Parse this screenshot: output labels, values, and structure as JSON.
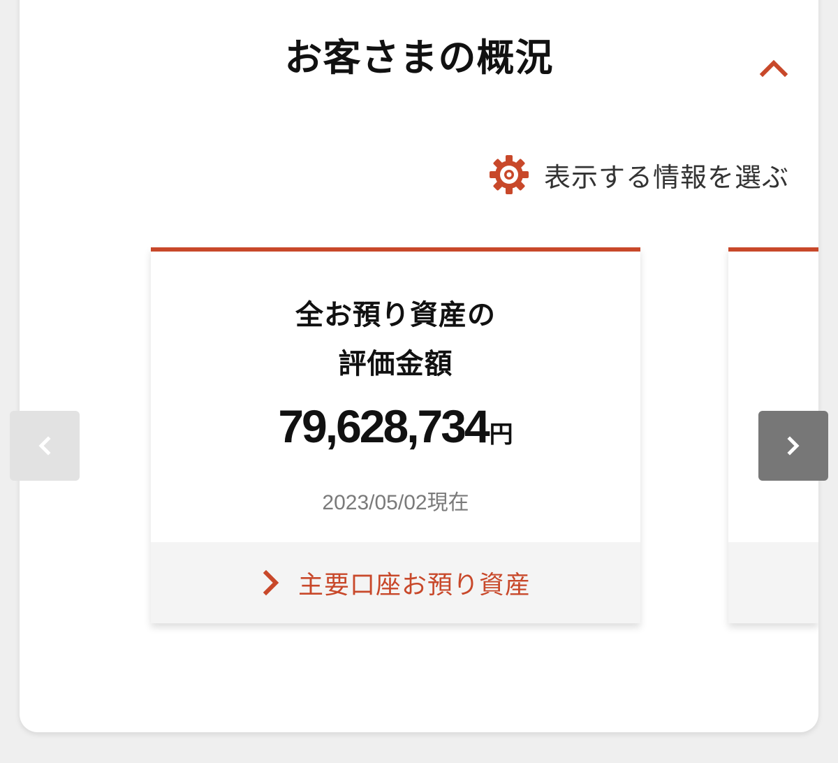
{
  "header": {
    "title": "お客さまの概況",
    "collapse_icon": "chevron-up-icon"
  },
  "settings": {
    "label": "表示する情報を選ぶ",
    "icon": "gear-icon"
  },
  "carousel": {
    "cards": [
      {
        "title_line1": "全お預り資産の",
        "title_line2": "評価金額",
        "amount": "79,628,734",
        "unit": "円",
        "as_of": "2023/05/02現在",
        "link_label": "主要口座お預り資産"
      }
    ],
    "prev_icon": "chevron-left-icon",
    "next_icon": "chevron-right-icon"
  },
  "colors": {
    "accent": "#c8482a",
    "panel_bg": "#ffffff",
    "page_bg": "#efefef",
    "footer_bg": "#f4f4f4",
    "next_button_bg": "#777777",
    "prev_button_bg": "#e2e2e2"
  }
}
